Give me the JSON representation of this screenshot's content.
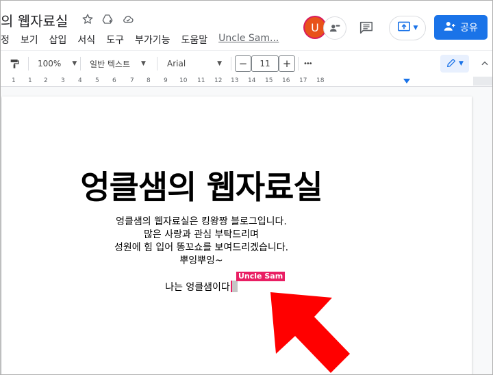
{
  "header": {
    "doc_title": "의 웹자료실",
    "star_icon": "star-icon",
    "drive_icon": "move-to-drive-icon",
    "cloud_icon": "cloud-status-icon"
  },
  "menu": {
    "items": [
      "정",
      "보기",
      "삽입",
      "서식",
      "도구",
      "부가기능",
      "도움말"
    ],
    "last_edit": "Uncle Sam..."
  },
  "collaborators": {
    "user_initial": "U"
  },
  "share": {
    "label": "공유"
  },
  "toolbar": {
    "zoom": "100%",
    "style": "일반 텍스트",
    "font": "Arial",
    "font_size": "11",
    "minus": "−",
    "plus": "+",
    "more": "•••"
  },
  "ruler": {
    "numbers": [
      "1",
      "1",
      "2",
      "3",
      "4",
      "5",
      "6",
      "7",
      "8",
      "9",
      "10",
      "11",
      "12",
      "13",
      "14",
      "15",
      "16",
      "17",
      "18"
    ]
  },
  "document": {
    "heading": "엉클샘의 웹자료실",
    "lines": [
      "엉클샘의 웹자료실은 킹왕짱 블로그입니다.",
      "많은 사랑과 관심 부탁드리며",
      "성원에 힘 입어 똥꼬쇼를 보여드리겠습니다.",
      "뿌잉뿌잉~"
    ],
    "last_line": "나는 엉클샘이다",
    "cursor_label": "Uncle Sam"
  },
  "colors": {
    "accent": "#1a73e8",
    "cursor": "#e91e63",
    "arrow": "#ff0000",
    "avatar": "#e8521a"
  }
}
